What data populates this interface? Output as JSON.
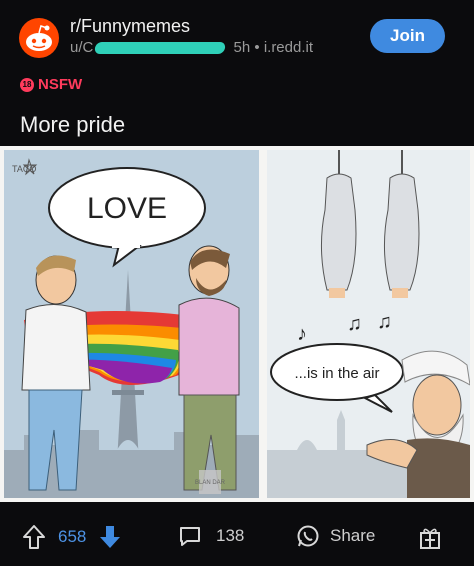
{
  "post": {
    "subreddit": "r/Funnymemes",
    "user_prefix": "u/C",
    "time": "5h",
    "separator": "•",
    "domain": "i.redd.it",
    "join_label": "Join",
    "nsfw_badge": "18",
    "nsfw_label": "NSFW",
    "title": "More pride"
  },
  "image": {
    "left_bubble": "LOVE",
    "right_bubble": "...is in the air",
    "signature": "TACO",
    "watermark": "BLAN DAR"
  },
  "actions": {
    "upvotes": "658",
    "comments": "138",
    "share_label": "Share"
  },
  "colors": {
    "background": "#0b0b0d",
    "join_blue": "#3f8ae0",
    "downvote_blue": "#3f8ae0",
    "nsfw_red": "#ff3b5c",
    "brand_orange": "#ff4500"
  }
}
